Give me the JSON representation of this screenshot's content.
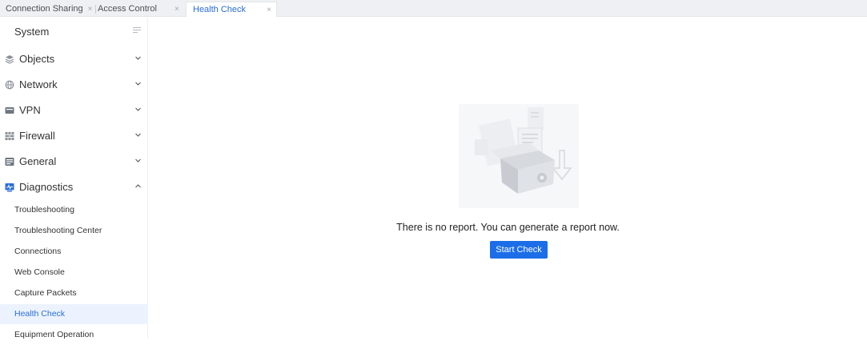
{
  "tabs": [
    {
      "label": "Connection Sharing",
      "close": "×"
    },
    {
      "label": "Access Control",
      "close": "×"
    },
    {
      "label": "Health Check",
      "close": "×"
    }
  ],
  "sidebar": {
    "title": "System",
    "menu": [
      {
        "label": "Objects",
        "icon": "layers-icon",
        "expanded": false
      },
      {
        "label": "Network",
        "icon": "globe-icon",
        "expanded": false
      },
      {
        "label": "VPN",
        "icon": "vpn-icon",
        "expanded": false
      },
      {
        "label": "Firewall",
        "icon": "firewall-icon",
        "expanded": false
      },
      {
        "label": "General",
        "icon": "general-icon",
        "expanded": false
      },
      {
        "label": "Diagnostics",
        "icon": "diagnostics-icon",
        "expanded": true
      }
    ],
    "diagnostics_items": [
      {
        "label": "Troubleshooting"
      },
      {
        "label": "Troubleshooting Center"
      },
      {
        "label": "Connections"
      },
      {
        "label": "Web Console"
      },
      {
        "label": "Capture Packets"
      },
      {
        "label": "Health Check",
        "selected": true
      },
      {
        "label": "Equipment Operation"
      }
    ]
  },
  "main": {
    "empty_message": "There is no report. You can generate a report now.",
    "start_button": "Start Check"
  },
  "colors": {
    "accent": "#1c6ee8",
    "selected_bg": "#ecf3fe",
    "tabbar_bg": "#eef0f3"
  }
}
